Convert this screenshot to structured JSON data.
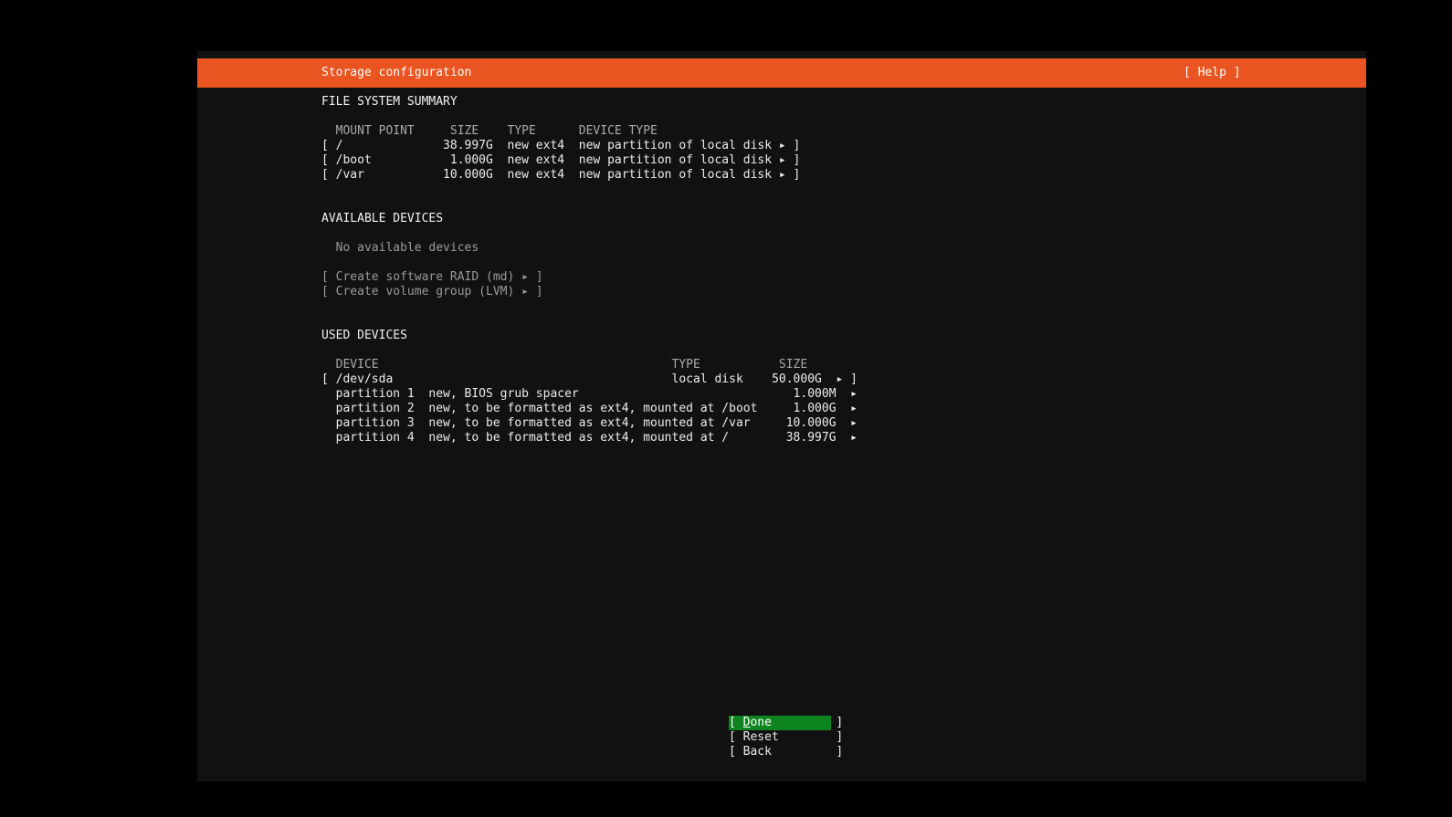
{
  "header": {
    "title": "Storage configuration",
    "help": "[ Help ]"
  },
  "fs_summary": {
    "heading": "FILE SYSTEM SUMMARY",
    "columns": "  MOUNT POINT     SIZE    TYPE      DEVICE TYPE",
    "rows": [
      "[ /              38.997G  new ext4  new partition of local disk ▸ ]",
      "[ /boot           1.000G  new ext4  new partition of local disk ▸ ]",
      "[ /var           10.000G  new ext4  new partition of local disk ▸ ]"
    ]
  },
  "available": {
    "heading": "AVAILABLE DEVICES",
    "empty": "  No available devices",
    "actions": [
      "[ Create software RAID (md) ▸ ]",
      "[ Create volume group (LVM) ▸ ]"
    ]
  },
  "used": {
    "heading": "USED DEVICES",
    "columns": "  DEVICE                                         TYPE           SIZE",
    "device": "[ /dev/sda                                       local disk    50.000G  ▸ ]",
    "partitions": [
      "  partition 1  new, BIOS grub spacer                              1.000M  ▸",
      "  partition 2  new, to be formatted as ext4, mounted at /boot     1.000G  ▸",
      "  partition 3  new, to be formatted as ext4, mounted at /var     10.000G  ▸",
      "  partition 4  new, to be formatted as ext4, mounted at /        38.997G  ▸"
    ]
  },
  "buttons": {
    "done_prefix": "[ ",
    "done_hotkey": "D",
    "done_rest": "one         ]",
    "reset": "[ Reset        ]",
    "back": "[ Back         ]"
  }
}
